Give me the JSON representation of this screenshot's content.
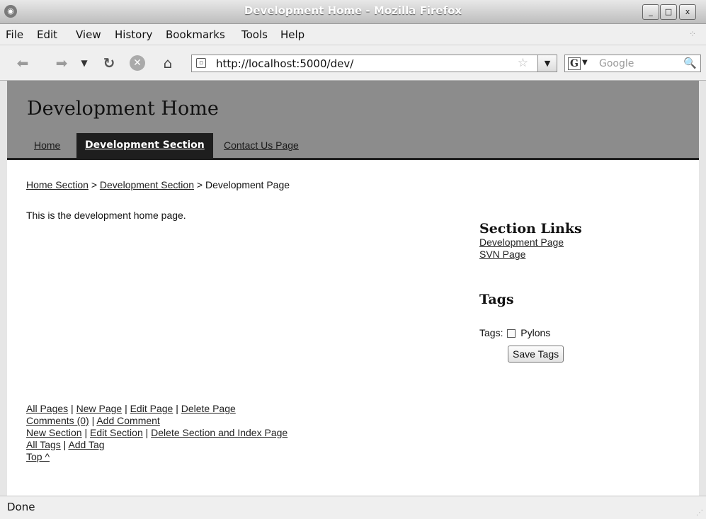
{
  "window": {
    "title": "Development Home - Mozilla Firefox",
    "controls": {
      "minimize": "_",
      "maximize": "□",
      "close": "x"
    }
  },
  "menubar": {
    "items": [
      "File",
      "Edit",
      "View",
      "History",
      "Bookmarks",
      "Tools",
      "Help"
    ]
  },
  "toolbar": {
    "back_icon": "back-arrow-icon",
    "forward_icon": "forward-arrow-icon",
    "url": "http://localhost:5000/dev/",
    "search_placeholder": "Google",
    "search_engine_glyph": "G"
  },
  "page": {
    "site_title": "Development Home",
    "nav_tabs": [
      {
        "label": "Home",
        "active": false
      },
      {
        "label": "Development Section",
        "active": true
      },
      {
        "label": "Contact Us Page",
        "active": false
      }
    ],
    "breadcrumb": {
      "items": [
        "Home Section",
        "Development Section"
      ],
      "separator": ">",
      "current": "Development Page"
    },
    "intro_text": "This is the development home page.",
    "sidebar": {
      "section_links_title": "Section Links",
      "section_links": [
        "Development Page",
        "SVN Page"
      ],
      "tags_title": "Tags",
      "tags_label": "Tags:",
      "tag_options": [
        {
          "label": "Pylons",
          "checked": false
        }
      ],
      "save_button": "Save Tags"
    },
    "footer": {
      "row1": [
        "All Pages",
        "New Page",
        "Edit Page",
        "Delete Page"
      ],
      "row2": [
        "Comments (0)",
        "Add Comment"
      ],
      "row3": [
        "New Section",
        "Edit Section",
        "Delete Section and Index Page"
      ],
      "row4": [
        "All Tags",
        "Add Tag"
      ],
      "top_link": "Top ^",
      "separator": "|"
    }
  },
  "statusbar": {
    "text": "Done"
  }
}
